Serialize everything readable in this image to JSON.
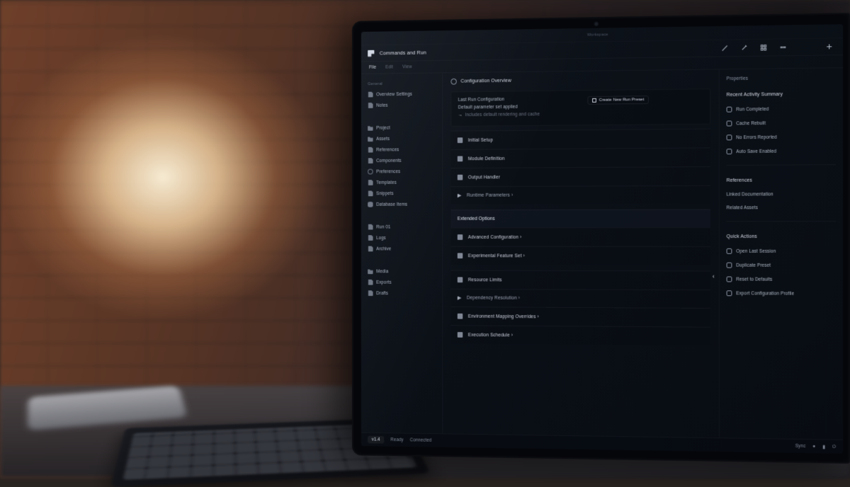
{
  "window": {
    "top_hint": "Workspace"
  },
  "titlebar": {
    "title": "Commands and Run",
    "tools": [
      "edit",
      "pen",
      "grid",
      "more"
    ]
  },
  "tabs": {
    "items": [
      "File",
      "Edit",
      "View"
    ],
    "active_index": 0
  },
  "sidebar": {
    "sections": [
      {
        "heading": "General",
        "items": [
          {
            "icon": "doc",
            "label": "Overview Settings"
          },
          {
            "icon": "doc",
            "label": "Notes"
          }
        ]
      },
      {
        "heading": "",
        "items": [
          {
            "icon": "folder",
            "label": "Project"
          },
          {
            "icon": "folder",
            "label": "Assets"
          },
          {
            "icon": "doc",
            "label": "References"
          },
          {
            "icon": "doc",
            "label": "Components"
          },
          {
            "icon": "gear",
            "label": "Preferences"
          },
          {
            "icon": "doc",
            "label": "Templates"
          },
          {
            "icon": "doc",
            "label": "Snippets"
          },
          {
            "icon": "db",
            "label": "Database Items"
          }
        ]
      },
      {
        "heading": "",
        "items": [
          {
            "icon": "doc",
            "label": "Run 01"
          },
          {
            "icon": "doc",
            "label": "Logs"
          },
          {
            "icon": "doc",
            "label": "Archive"
          }
        ]
      },
      {
        "heading": "",
        "items": [
          {
            "icon": "folder",
            "label": "Media"
          },
          {
            "icon": "doc",
            "label": "Exports"
          },
          {
            "icon": "doc",
            "label": "Drafts"
          }
        ]
      }
    ]
  },
  "main": {
    "header": {
      "label": "Configuration Overview"
    },
    "panel": {
      "left_lines": [
        "Last Run Configuration",
        "Default parameter set applied"
      ],
      "left_sub": "Includes default rendering and cache",
      "right_button": "Create New Run Preset"
    },
    "rows": [
      {
        "type": "row",
        "icon": "dash",
        "label": "Initial Setup"
      },
      {
        "type": "row",
        "icon": "dash",
        "label": "Module Definition"
      },
      {
        "type": "row",
        "icon": "dash",
        "label": "Output Handler"
      },
      {
        "type": "row",
        "icon": "tri",
        "label": "Runtime Parameters ›",
        "sub": true
      },
      {
        "type": "gap"
      },
      {
        "type": "group",
        "icon": "",
        "label": "Extended Options"
      },
      {
        "type": "row",
        "icon": "dash",
        "label": "Advanced Configuration ›"
      },
      {
        "type": "row",
        "icon": "dash",
        "label": "Experimental Feature Set ›"
      },
      {
        "type": "gap"
      },
      {
        "type": "row",
        "icon": "dash",
        "label": "Resource Limits"
      },
      {
        "type": "row",
        "icon": "tri",
        "label": "Dependency Resolution ›",
        "sub": true
      },
      {
        "type": "row",
        "icon": "dash",
        "label": "Environment Mapping Overrides ›"
      },
      {
        "type": "row",
        "icon": "dash",
        "label": "Execution Schedule ›"
      }
    ]
  },
  "right": {
    "title": "Properties",
    "heading1": "Recent Activity Summary",
    "items1": [
      "Run Completed",
      "Cache Rebuilt",
      "No Errors Reported",
      "Auto Save Enabled"
    ],
    "heading2": "References",
    "items2": [
      "Linked Documentation",
      "Related Assets"
    ],
    "heading3": "Quick Actions",
    "items3": [
      "Open Last Session",
      "Duplicate Preset",
      "Reset to Defaults",
      "Export Configuration Profile"
    ]
  },
  "status": {
    "left_pill": "v1.4",
    "left_items": [
      "Ready",
      "Connected"
    ],
    "right_items": [
      "Sync",
      "●",
      "▮",
      "⏻"
    ]
  }
}
